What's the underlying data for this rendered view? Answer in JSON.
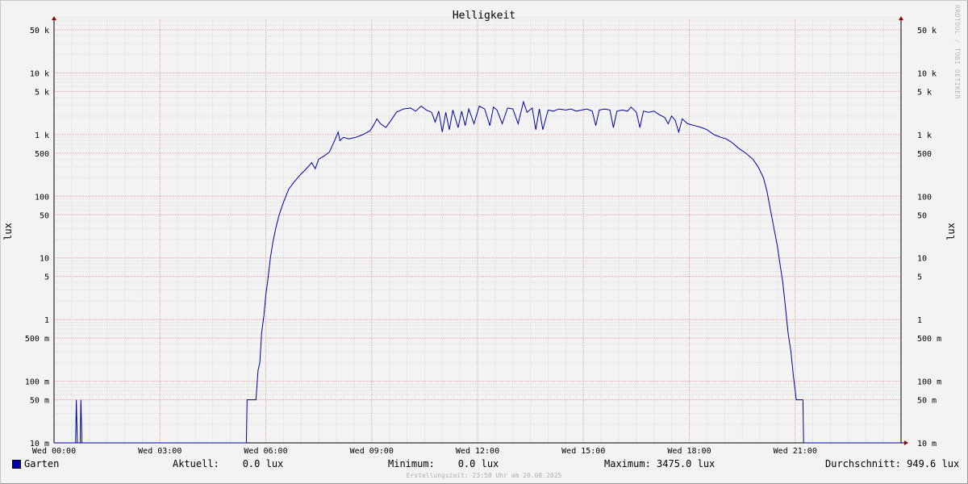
{
  "chart_data": {
    "type": "line",
    "title": "Helligkeit",
    "ylabel": "lux",
    "ylabel_right": "lux",
    "yscale": "log",
    "ylim": [
      0.01,
      80000
    ],
    "grid": true,
    "x_ticks": [
      {
        "hour": 0,
        "label": "Wed 00:00"
      },
      {
        "hour": 3,
        "label": "Wed 03:00"
      },
      {
        "hour": 6,
        "label": "Wed 06:00"
      },
      {
        "hour": 9,
        "label": "Wed 09:00"
      },
      {
        "hour": 12,
        "label": "Wed 12:00"
      },
      {
        "hour": 15,
        "label": "Wed 15:00"
      },
      {
        "hour": 18,
        "label": "Wed 18:00"
      },
      {
        "hour": 21,
        "label": "Wed 21:00"
      }
    ],
    "xlim": [
      0,
      24
    ],
    "y_ticks": [
      {
        "value": 0.01,
        "label": "10 m"
      },
      {
        "value": 0.05,
        "label": "50 m"
      },
      {
        "value": 0.1,
        "label": "100 m"
      },
      {
        "value": 0.5,
        "label": "500 m"
      },
      {
        "value": 1,
        "label": "1"
      },
      {
        "value": 5,
        "label": "5"
      },
      {
        "value": 10,
        "label": "10"
      },
      {
        "value": 50,
        "label": "50"
      },
      {
        "value": 100,
        "label": "100"
      },
      {
        "value": 500,
        "label": "500"
      },
      {
        "value": 1000,
        "label": "1 k"
      },
      {
        "value": 5000,
        "label": "5 k"
      },
      {
        "value": 10000,
        "label": "10 k"
      },
      {
        "value": 50000,
        "label": "50 k"
      }
    ],
    "series": [
      {
        "name": "Garten",
        "color": "#0000aa",
        "points": [
          [
            0,
            0.01
          ],
          [
            0.61,
            0.01
          ],
          [
            0.63,
            0.05
          ],
          [
            0.66,
            0.01
          ],
          [
            0.74,
            0.01
          ],
          [
            0.76,
            0.05
          ],
          [
            0.79,
            0.01
          ],
          [
            5.45,
            0.01
          ],
          [
            5.47,
            0.05
          ],
          [
            5.72,
            0.05
          ],
          [
            5.78,
            0.15
          ],
          [
            5.83,
            0.2
          ],
          [
            5.88,
            0.6
          ],
          [
            5.95,
            1.2
          ],
          [
            6.0,
            2.5
          ],
          [
            6.06,
            4.5
          ],
          [
            6.13,
            10
          ],
          [
            6.2,
            18
          ],
          [
            6.28,
            30
          ],
          [
            6.38,
            50
          ],
          [
            6.5,
            80
          ],
          [
            6.65,
            130
          ],
          [
            6.8,
            170
          ],
          [
            7.0,
            230
          ],
          [
            7.15,
            280
          ],
          [
            7.3,
            350
          ],
          [
            7.4,
            280
          ],
          [
            7.5,
            400
          ],
          [
            7.65,
            450
          ],
          [
            7.8,
            520
          ],
          [
            7.95,
            800
          ],
          [
            8.05,
            1100
          ],
          [
            8.1,
            800
          ],
          [
            8.2,
            900
          ],
          [
            8.35,
            850
          ],
          [
            8.55,
            900
          ],
          [
            8.75,
            1000
          ],
          [
            8.95,
            1150
          ],
          [
            9.05,
            1400
          ],
          [
            9.15,
            1800
          ],
          [
            9.25,
            1500
          ],
          [
            9.4,
            1300
          ],
          [
            9.55,
            1700
          ],
          [
            9.7,
            2300
          ],
          [
            9.9,
            2600
          ],
          [
            10.1,
            2700
          ],
          [
            10.25,
            2400
          ],
          [
            10.4,
            2900
          ],
          [
            10.55,
            2500
          ],
          [
            10.7,
            2300
          ],
          [
            10.8,
            1600
          ],
          [
            10.9,
            2400
          ],
          [
            11.0,
            1100
          ],
          [
            11.1,
            2300
          ],
          [
            11.2,
            1200
          ],
          [
            11.3,
            2500
          ],
          [
            11.45,
            1300
          ],
          [
            11.55,
            2400
          ],
          [
            11.65,
            1400
          ],
          [
            11.75,
            2600
          ],
          [
            11.9,
            1500
          ],
          [
            12.05,
            2900
          ],
          [
            12.2,
            2600
          ],
          [
            12.35,
            1400
          ],
          [
            12.45,
            2800
          ],
          [
            12.55,
            2500
          ],
          [
            12.7,
            1500
          ],
          [
            12.85,
            2700
          ],
          [
            13.0,
            2600
          ],
          [
            13.15,
            1500
          ],
          [
            13.3,
            3400
          ],
          [
            13.4,
            2300
          ],
          [
            13.55,
            2700
          ],
          [
            13.65,
            1200
          ],
          [
            13.75,
            2600
          ],
          [
            13.85,
            1200
          ],
          [
            14.0,
            2500
          ],
          [
            14.15,
            2400
          ],
          [
            14.3,
            2600
          ],
          [
            14.5,
            2500
          ],
          [
            14.65,
            2600
          ],
          [
            14.8,
            2400
          ],
          [
            14.95,
            2500
          ],
          [
            15.1,
            2600
          ],
          [
            15.25,
            2400
          ],
          [
            15.35,
            1400
          ],
          [
            15.45,
            2500
          ],
          [
            15.6,
            2600
          ],
          [
            15.75,
            2500
          ],
          [
            15.85,
            1300
          ],
          [
            15.95,
            2400
          ],
          [
            16.1,
            2500
          ],
          [
            16.25,
            2400
          ],
          [
            16.35,
            2800
          ],
          [
            16.5,
            2300
          ],
          [
            16.6,
            1300
          ],
          [
            16.7,
            2400
          ],
          [
            16.85,
            2300
          ],
          [
            17.0,
            2400
          ],
          [
            17.15,
            2100
          ],
          [
            17.3,
            1900
          ],
          [
            17.4,
            1500
          ],
          [
            17.5,
            2000
          ],
          [
            17.6,
            1700
          ],
          [
            17.7,
            1100
          ],
          [
            17.8,
            1800
          ],
          [
            17.95,
            1500
          ],
          [
            18.15,
            1400
          ],
          [
            18.35,
            1300
          ],
          [
            18.5,
            1200
          ],
          [
            18.7,
            1000
          ],
          [
            18.9,
            900
          ],
          [
            19.05,
            850
          ],
          [
            19.2,
            750
          ],
          [
            19.4,
            600
          ],
          [
            19.6,
            500
          ],
          [
            19.8,
            400
          ],
          [
            19.95,
            300
          ],
          [
            20.1,
            200
          ],
          [
            20.2,
            120
          ],
          [
            20.3,
            60
          ],
          [
            20.4,
            30
          ],
          [
            20.5,
            15
          ],
          [
            20.57,
            8
          ],
          [
            20.65,
            4
          ],
          [
            20.73,
            1.5
          ],
          [
            20.8,
            0.6
          ],
          [
            20.88,
            0.3
          ],
          [
            20.95,
            0.12
          ],
          [
            21.0,
            0.07
          ],
          [
            21.03,
            0.05
          ],
          [
            21.22,
            0.05
          ],
          [
            21.24,
            0.01
          ],
          [
            24,
            0.01
          ]
        ]
      }
    ],
    "legend": {
      "series_label": "Garten",
      "current": "Aktuell:    0.0 lux",
      "minimum": "Minimum:    0.0 lux",
      "maximum": "Maximum: 3475.0 lux",
      "average": "Durchschnitt: 949.6 lux"
    },
    "footer": "Erstellungszeit: 23:58 Uhr am 20.08.2025",
    "credit": "RRDTOOL / TOBI OETIKER"
  }
}
